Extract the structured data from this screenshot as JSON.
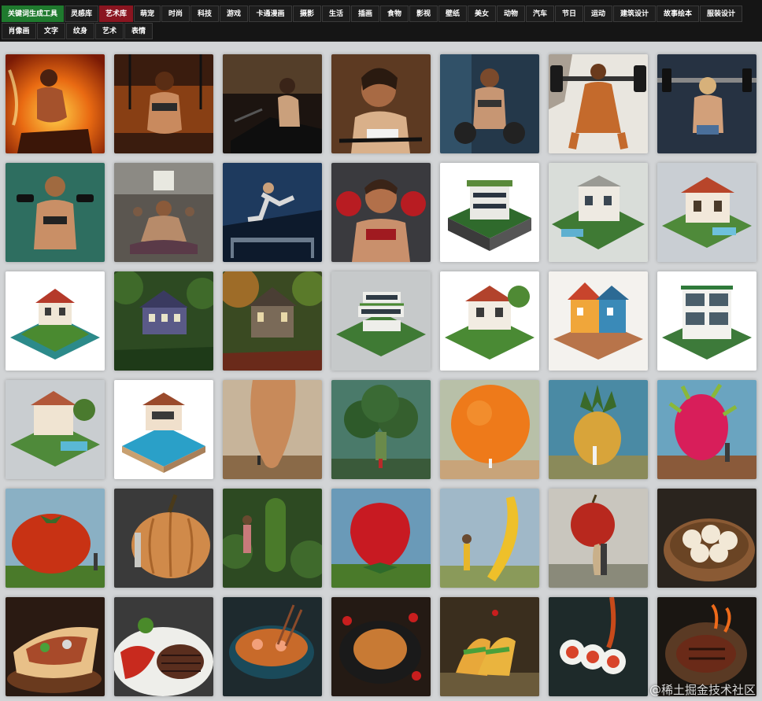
{
  "nav": {
    "primary_label": "关键词生成工具",
    "active_label": "艺术库",
    "row1": [
      "灵感库",
      "艺术库",
      "萌宠",
      "时尚",
      "科技",
      "游戏",
      "卡通漫画",
      "摄影",
      "生活",
      "插画",
      "食物",
      "影视",
      "壁纸",
      "美女",
      "动物",
      "汽车",
      "节日",
      "运动",
      "建筑设计",
      "故事绘本",
      "服装设计"
    ],
    "row2": [
      "肖像画",
      "文字",
      "纹身",
      "艺术",
      "表情"
    ]
  },
  "watermark": "@稀土掘金技术社区",
  "colors": {
    "topbar": "#151515",
    "primary": "#1f7a2e",
    "active": "#8a1520",
    "page": "#d2d4d6"
  }
}
